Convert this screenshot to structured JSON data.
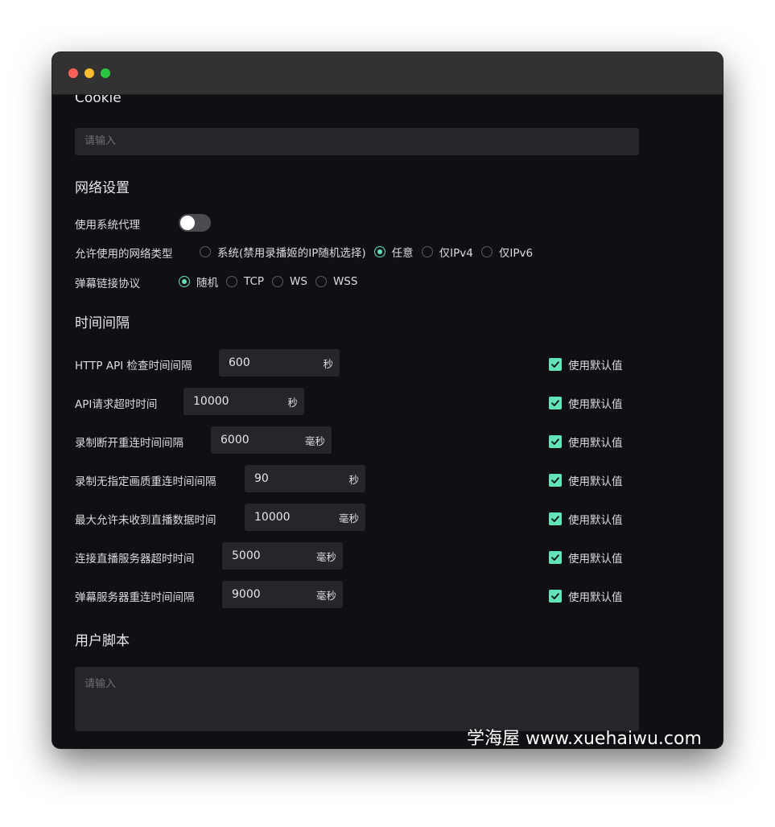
{
  "window": {
    "controls": [
      "close",
      "minimize",
      "zoom"
    ]
  },
  "cookie": {
    "title": "Cookie",
    "placeholder": "请输入"
  },
  "network": {
    "title": "网络设置",
    "system_proxy_label": "使用系统代理",
    "system_proxy_on": false,
    "net_type_label": "允许使用的网络类型",
    "net_type_options": [
      "系统(禁用录播姬的IP随机选择)",
      "任意",
      "仅IPv4",
      "仅IPv6"
    ],
    "net_type_selected": 1,
    "protocol_label": "弹幕链接协议",
    "protocol_options": [
      "随机",
      "TCP",
      "WS",
      "WSS"
    ],
    "protocol_selected": 0
  },
  "intervals": {
    "title": "时间间隔",
    "default_label": "使用默认值",
    "rows": [
      {
        "label": "HTTP API 检查时间间隔",
        "value": "600",
        "unit": "秒",
        "use_default": true
      },
      {
        "label": "API请求超时时间",
        "value": "10000",
        "unit": "秒",
        "use_default": true
      },
      {
        "label": "录制断开重连时间间隔",
        "value": "6000",
        "unit": "毫秒",
        "use_default": true
      },
      {
        "label": "录制无指定画质重连时间间隔",
        "value": "90",
        "unit": "秒",
        "use_default": true
      },
      {
        "label": "最大允许未收到直播数据时间",
        "value": "10000",
        "unit": "毫秒",
        "use_default": true
      },
      {
        "label": "连接直播服务器超时时间",
        "value": "5000",
        "unit": "毫秒",
        "use_default": true
      },
      {
        "label": "弹幕服务器重连时间间隔",
        "value": "9000",
        "unit": "毫秒",
        "use_default": true
      }
    ]
  },
  "user_script": {
    "title": "用户脚本",
    "placeholder": "请输入"
  },
  "watermark": "学海屋 www.xuehaiwu.com",
  "colors": {
    "accent": "#63e2b7",
    "background": "#101014",
    "input_bg": "#26262a",
    "titlebar": "#323232"
  }
}
